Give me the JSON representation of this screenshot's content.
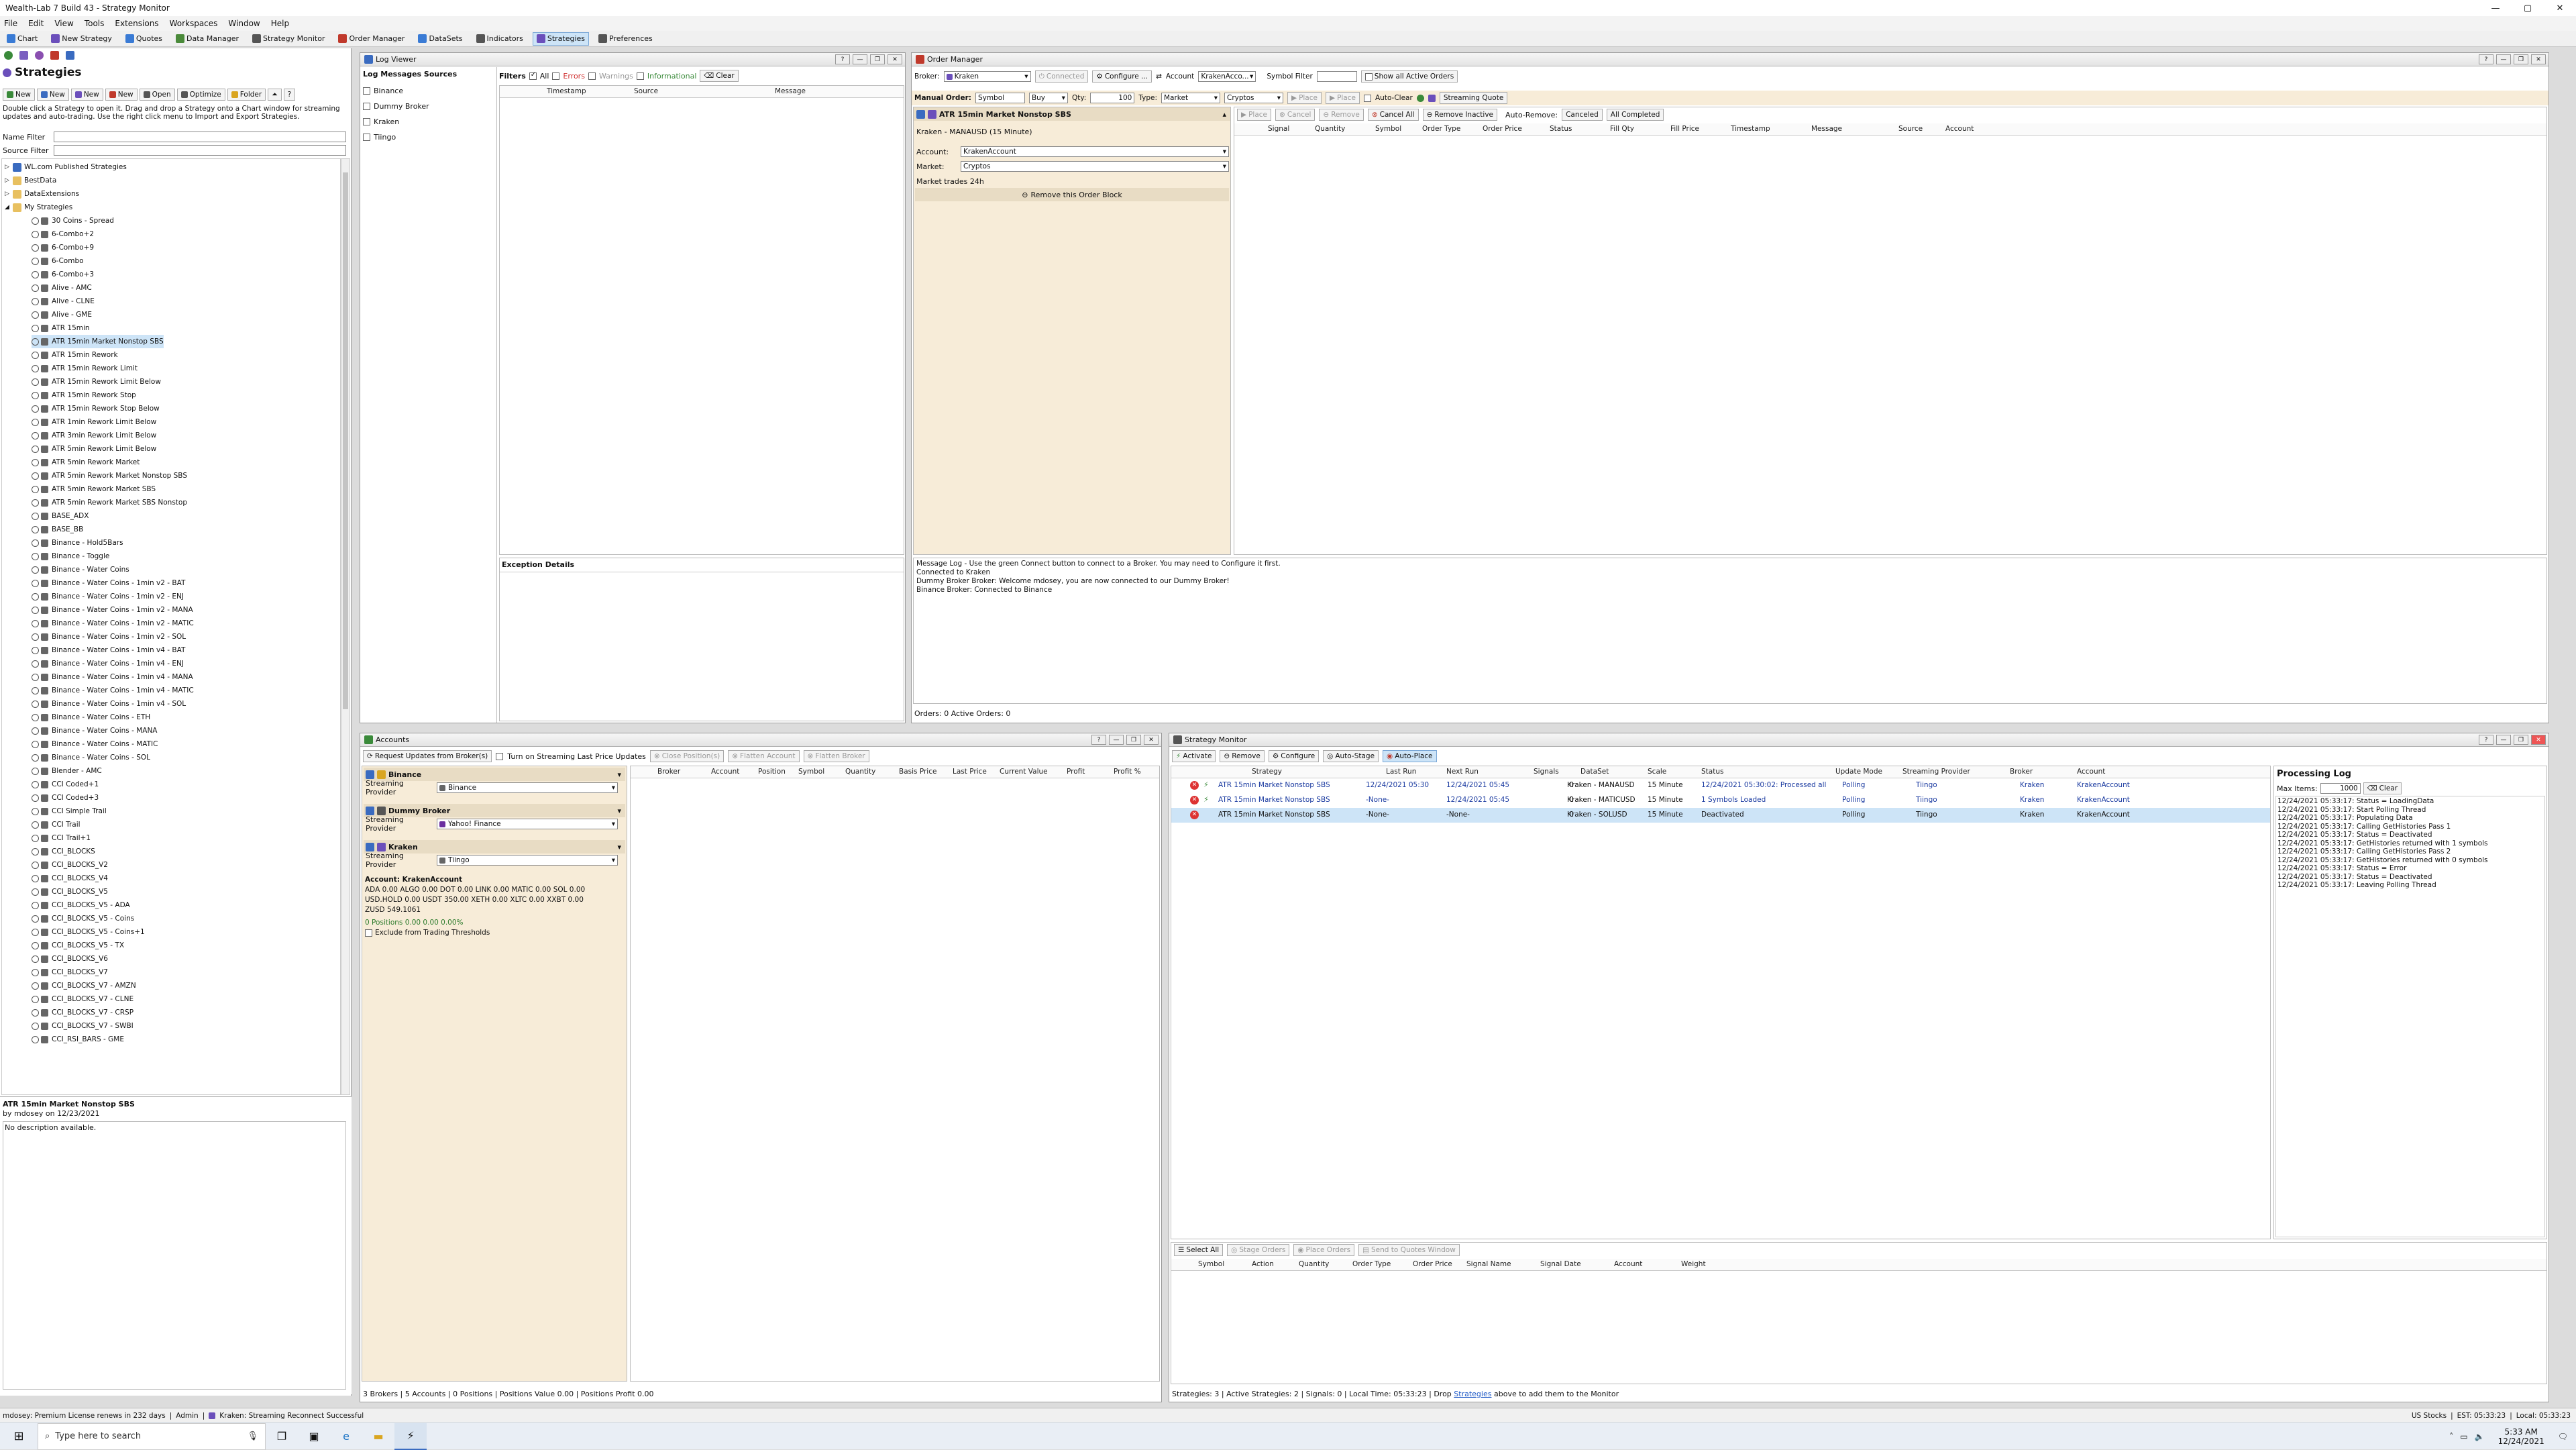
{
  "window": {
    "title": "Wealth-Lab 7 Build 43 - Strategy Monitor"
  },
  "menu": [
    "File",
    "Edit",
    "View",
    "Tools",
    "Extensions",
    "Workspaces",
    "Window",
    "Help"
  ],
  "toolbar": [
    {
      "label": "Chart",
      "color": "#3a7bd5"
    },
    {
      "label": "New Strategy",
      "color": "#6b4fbb"
    },
    {
      "label": "Quotes",
      "color": "#3a7bd5"
    },
    {
      "label": "Data Manager",
      "color": "#4a8a3a"
    },
    {
      "label": "Strategy Monitor",
      "color": "#555555"
    },
    {
      "label": "Order Manager",
      "color": "#c0392b"
    },
    {
      "label": "DataSets",
      "color": "#3a7bd5"
    },
    {
      "label": "Indicators",
      "color": "#555555"
    },
    {
      "label": "Strategies",
      "color": "#6b4fbb",
      "active": true
    },
    {
      "label": "Preferences",
      "color": "#555555"
    }
  ],
  "strategies": {
    "title": "Strategies",
    "buttons": [
      "New",
      "New",
      "New",
      "New",
      "Open",
      "Optimize",
      "Folder"
    ],
    "help": "Double click a Strategy to open it. Drag and drop a Strategy onto a Chart window for streaming updates and auto-trading. Use the right click menu to Import and Export Strategies.",
    "name_filter": "Name Filter",
    "source_filter": "Source Filter",
    "folders": [
      "WL.com Published Strategies",
      "BestData",
      "DataExtensions",
      "My Strategies"
    ],
    "items": [
      "30 Coins - Spread",
      "6-Combo+2",
      "6-Combo+9",
      "6-Combo",
      "6-Combo+3",
      "Alive - AMC",
      "Alive - CLNE",
      "Alive - GME",
      "ATR 15min",
      "ATR 15min Market Nonstop SBS",
      "ATR 15min Rework",
      "ATR 15min Rework Limit",
      "ATR 15min Rework Limit Below",
      "ATR 15min Rework Stop",
      "ATR 15min Rework Stop Below",
      "ATR 1min Rework Limit Below",
      "ATR 3min Rework Limit Below",
      "ATR 5min Rework Limit Below",
      "ATR 5min Rework Market",
      "ATR 5min Rework Market Nonstop SBS",
      "ATR 5min Rework Market SBS",
      "ATR 5min Rework Market SBS Nonstop",
      "BASE_ADX",
      "BASE_BB",
      "Binance - Hold5Bars",
      "Binance - Toggle",
      "Binance - Water Coins",
      "Binance - Water Coins - 1min v2 - BAT",
      "Binance - Water Coins - 1min v2 - ENJ",
      "Binance - Water Coins - 1min v2 - MANA",
      "Binance - Water Coins - 1min v2 - MATIC",
      "Binance - Water Coins - 1min v2 - SOL",
      "Binance - Water Coins - 1min v4 - BAT",
      "Binance - Water Coins - 1min v4 - ENJ",
      "Binance - Water Coins - 1min v4 - MANA",
      "Binance - Water Coins - 1min v4 - MATIC",
      "Binance - Water Coins - 1min v4 - SOL",
      "Binance - Water Coins - ETH",
      "Binance - Water Coins - MANA",
      "Binance - Water Coins - MATIC",
      "Binance - Water Coins - SOL",
      "Blender - AMC",
      "CCI Coded+1",
      "CCI Coded+3",
      "CCI Simple Trail",
      "CCI Trail",
      "CCI Trail+1",
      "CCI_BLOCKS",
      "CCI_BLOCKS_V2",
      "CCI_BLOCKS_V4",
      "CCI_BLOCKS_V5",
      "CCI_BLOCKS_V5 - ADA",
      "CCI_BLOCKS_V5 - Coins",
      "CCI_BLOCKS_V5 - Coins+1",
      "CCI_BLOCKS_V5 - TX",
      "CCI_BLOCKS_V6",
      "CCI_BLOCKS_V7",
      "CCI_BLOCKS_V7 - AMZN",
      "CCI_BLOCKS_V7 - CLNE",
      "CCI_BLOCKS_V7 - CRSP",
      "CCI_BLOCKS_V7 - SWBI",
      "CCI_RSI_BARS - GME"
    ],
    "selected": "ATR 15min Market Nonstop SBS",
    "detail_title": "ATR 15min Market Nonstop SBS",
    "detail_by": "by mdosey on 12/23/2021",
    "detail_desc": "No description available."
  },
  "log_viewer": {
    "title": "Log Viewer",
    "sources_label": "Log Messages Sources",
    "sources": [
      "Binance",
      "Dummy Broker",
      "Kraken",
      "Tiingo"
    ],
    "filters_label": "Filters",
    "filters": [
      {
        "label": "All",
        "color": "#111111"
      },
      {
        "label": "Errors",
        "color": "#d03030"
      },
      {
        "label": "Warnings",
        "color": "#999999"
      },
      {
        "label": "Informational",
        "color": "#3a8a3a"
      }
    ],
    "clear": "Clear",
    "cols": [
      "Timestamp",
      "Source",
      "Message"
    ],
    "exception_label": "Exception Details"
  },
  "order_manager": {
    "title": "Order Manager",
    "broker_label": "Broker:",
    "broker": "Kraken",
    "connected": "Connected",
    "configure": "Configure ...",
    "account_label": "Account",
    "account": "KrakenAcco...",
    "symbol_filter_label": "Symbol Filter",
    "show_all": "Show all Active Orders",
    "manual_order_label": "Manual Order:",
    "symbol": "Symbol",
    "side": "Buy",
    "qty_label": "Qty:",
    "qty": "100",
    "type_label": "Type:",
    "type": "Market",
    "market": "Cryptos",
    "auto_clear": "Auto-Clear",
    "streaming_quote": "Streaming Quote",
    "order_buttons": [
      "Place",
      "Cancel",
      "Remove"
    ],
    "cancel_all": "Cancel All",
    "remove_inactive": "Remove Inactive",
    "auto_remove": "Auto-Remove:",
    "canceled": "Canceled",
    "all_completed": "All Completed",
    "cols": [
      "Signal",
      "Quantity",
      "Symbol",
      "Order Type",
      "Order Price",
      "Status",
      "Fill Qty",
      "Fill Price",
      "Timestamp",
      "Message",
      "Source",
      "Account"
    ],
    "block_title": "ATR 15min Market Nonstop SBS",
    "block_sub": "Kraken - MANAUSD (15 Minute)",
    "block_account_label": "Account:",
    "block_account": "KrakenAccount",
    "block_market_label": "Market:",
    "block_market": "Cryptos",
    "block_note": "Market trades 24h",
    "remove_block": "Remove this Order Block",
    "messages": [
      "Message Log - Use the green Connect button to connect to a Broker. You may need to Configure it first.",
      "Connected to Kraken",
      "Dummy Broker Broker: Welcome mdosey, you are now connected to our Dummy Broker!",
      "Binance Broker: Connected to Binance"
    ],
    "status": "Orders: 0    Active Orders: 0"
  },
  "accounts": {
    "title": "Accounts",
    "request_updates": "Request Updates from Broker(s)",
    "streaming_last": "Turn on Streaming Last Price Updates",
    "buttons": [
      "Close Position(s)",
      "Flatten Account",
      "Flatten Broker"
    ],
    "brokers": [
      {
        "name": "Binance",
        "provider": "Binance"
      },
      {
        "name": "Dummy Broker",
        "provider": "Yahoo! Finance"
      },
      {
        "name": "Kraken",
        "provider": "Tiingo"
      }
    ],
    "streaming_provider_label": "Streaming Provider",
    "account_line": "Account: KrakenAccount",
    "balances1": "ADA 0.00  ALGO 0.00  DOT 0.00  LINK 0.00  MATIC 0.00  SOL 0.00",
    "balances2": "USD.HOLD 0.00  USDT 350.00  XETH 0.00  XLTC 0.00  XXBT 0.00",
    "balances3": "ZUSD 549.1061",
    "positions_line": "0 Positions   0.00   0.00   0.00%",
    "exclude": "Exclude from Trading Thresholds",
    "cols": [
      "Broker",
      "Account",
      "Position",
      "Symbol",
      "Quantity",
      "Basis Price",
      "Last Price",
      "Current Value",
      "Profit",
      "Profit %"
    ],
    "status": "3 Brokers | 5 Accounts | 0 Positions | Positions Value 0.00 | Positions Profit 0.00"
  },
  "monitor": {
    "title": "Strategy Monitor",
    "buttons": [
      "Activate",
      "Remove",
      "Configure",
      "Auto-Stage",
      "Auto-Place"
    ],
    "cols": [
      "Strategy",
      "Last Run",
      "Next Run",
      "Signals",
      "DataSet",
      "Scale",
      "Status",
      "Update Mode",
      "Streaming Provider",
      "Broker",
      "Account"
    ],
    "rows": [
      {
        "strategy": "ATR 15min Market Nonstop SBS",
        "last_run": "12/24/2021 05:30",
        "next_run": "12/24/2021 05:45",
        "signals": "0",
        "dataset": "Kraken - MANAUSD",
        "scale": "15 Minute",
        "status": "12/24/2021 05:30:02: Processed all 5",
        "mode": "Polling",
        "provider": "Tiingo",
        "broker": "Kraken",
        "account": "KrakenAccount"
      },
      {
        "strategy": "ATR 15min Market Nonstop SBS",
        "last_run": "-None-",
        "next_run": "12/24/2021 05:45",
        "signals": "0",
        "dataset": "Kraken - MATICUSD",
        "scale": "15 Minute",
        "status": "1 Symbols Loaded",
        "mode": "Polling",
        "provider": "Tiingo",
        "broker": "Kraken",
        "account": "KrakenAccount"
      },
      {
        "strategy": "ATR 15min Market Nonstop SBS",
        "last_run": "-None-",
        "next_run": "-None-",
        "signals": "0",
        "dataset": "Kraken - SOLUSD",
        "scale": "15 Minute",
        "status": "Deactivated",
        "mode": "Polling",
        "provider": "Tiingo",
        "broker": "Kraken",
        "account": "KrakenAccount"
      }
    ],
    "processing_title": "Processing Log",
    "max_items_label": "Max Items:",
    "max_items": "1000",
    "clear": "Clear",
    "processing_log": [
      "12/24/2021 05:33:17: Status = LoadingData",
      "12/24/2021 05:33:17: Start Polling Thread",
      "12/24/2021 05:33:17: Populating Data",
      "12/24/2021 05:33:17: Calling GetHistories Pass 1",
      "12/24/2021 05:33:17: Status = Deactivated",
      "12/24/2021 05:33:17: GetHistories returned with 1 symbols",
      "12/24/2021 05:33:17: Calling GetHistories Pass 2",
      "12/24/2021 05:33:17: GetHistories returned with 0 symbols",
      "12/24/2021 05:33:17: Status = Error",
      "12/24/2021 05:33:17: Status = Deactivated",
      "12/24/2021 05:33:17: Leaving Polling Thread"
    ],
    "signal_buttons": [
      "Select All",
      "Stage Orders",
      "Place Orders",
      "Send to Quotes Window"
    ],
    "signal_cols": [
      "Symbol",
      "Action",
      "Quantity",
      "Order Type",
      "Order Price",
      "Signal Name",
      "Signal Date",
      "Account",
      "Weight"
    ],
    "status_prefix": "Strategies: 3 | Active Strategies: 2 | Signals: 0 | Local Time: 05:33:23 | Drop",
    "status_link": "Strategies",
    "status_suffix": "above to add them to the Monitor"
  },
  "statusbar": {
    "left": "mdosey: Premium License renews in 232 days",
    "admin": "Admin",
    "kraken": "Kraken: Streaming Reconnect Successful",
    "market": "US Stocks",
    "est": "EST: 05:33:23",
    "local": "Local: 05:33:23"
  },
  "taskbar": {
    "search": "Type here to search",
    "time": "5:33 AM",
    "date": "12/24/2021"
  }
}
